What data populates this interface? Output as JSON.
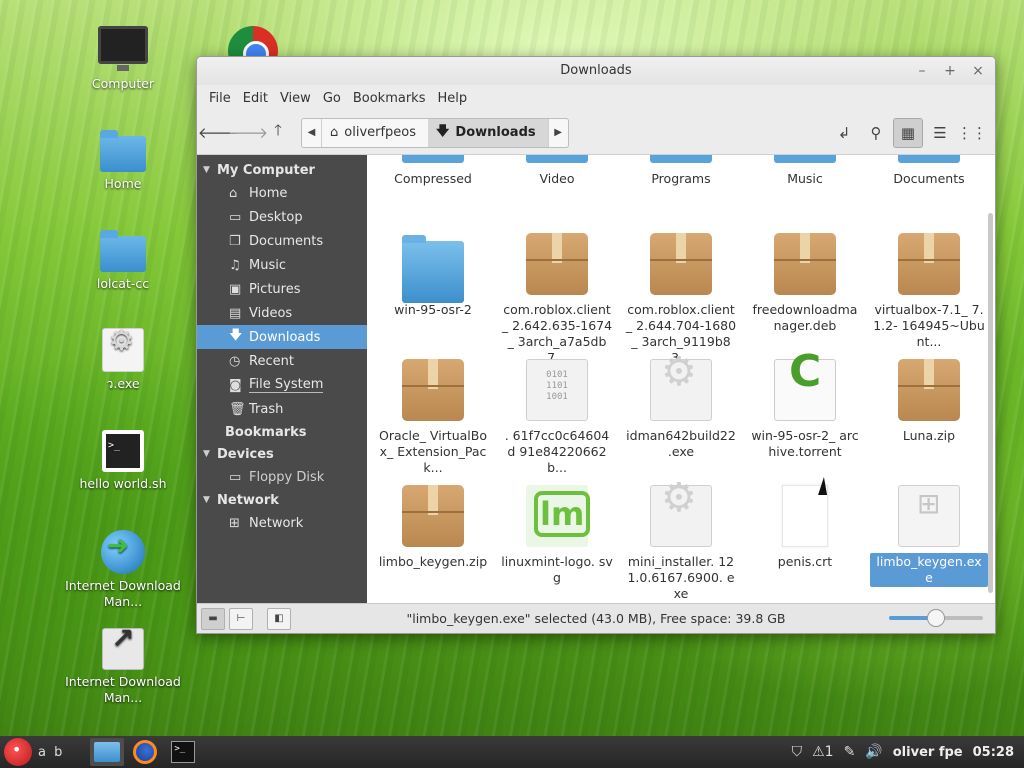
{
  "desktop": {
    "icons": [
      {
        "label": "Computer"
      },
      {
        "label": "Home"
      },
      {
        "label": "lolcat-cc"
      },
      {
        "label": "ว.exe"
      },
      {
        "label": "hello world.sh"
      },
      {
        "label": "Internet Download Man..."
      },
      {
        "label": "Internet Download Man..."
      }
    ]
  },
  "window": {
    "title": "Downloads",
    "controls": {
      "minimize": "–",
      "maximize": "+",
      "close": "×"
    },
    "menu": [
      "File",
      "Edit",
      "View",
      "Go",
      "Bookmarks",
      "Help"
    ],
    "path": {
      "home": "oliverfpeos",
      "current": "Downloads"
    },
    "sidebar": {
      "sections": [
        {
          "title": "My Computer",
          "items": [
            "Home",
            "Desktop",
            "Documents",
            "Music",
            "Pictures",
            "Videos",
            "Downloads",
            "Recent",
            "File System",
            "Trash"
          ]
        },
        {
          "title": "Bookmarks",
          "items": []
        },
        {
          "title": "Devices",
          "items": [
            "Floppy Disk"
          ]
        },
        {
          "title": "Network",
          "items": [
            "Network"
          ]
        }
      ]
    },
    "top_folders": [
      "Compressed",
      "Video",
      "Programs",
      "Music",
      "Documents"
    ],
    "files": [
      {
        "name": "win-95-osr-2",
        "kind": "folder"
      },
      {
        "name": "com.roblox.client_ 2.642.635-1674_ 3arch_a7a5db7...",
        "kind": "package"
      },
      {
        "name": "com.roblox.client_ 2.644.704-1680_ 3arch_9119b83...",
        "kind": "package"
      },
      {
        "name": "freedownloadma nager.deb",
        "kind": "package"
      },
      {
        "name": "virtualbox-7.1_ 7.1.2- 164945~Ubunt...",
        "kind": "package"
      },
      {
        "name": "Oracle_ VirtualBox_ Extension_Pack...",
        "kind": "package"
      },
      {
        "name": ". 61f7cc0c64604d 91e84220662b...",
        "kind": "binary"
      },
      {
        "name": "idman642build22 .exe",
        "kind": "gear"
      },
      {
        "name": "win-95-osr-2_ archive.torrent",
        "kind": "torrent"
      },
      {
        "name": "Luna.zip",
        "kind": "package"
      },
      {
        "name": "limbo_keygen.zip",
        "kind": "package"
      },
      {
        "name": "linuxmint-logo. svg",
        "kind": "mint"
      },
      {
        "name": "mini_installer. 121.0.6167.6900. exe",
        "kind": "gear"
      },
      {
        "name": "penis.crt",
        "kind": "blank"
      },
      {
        "name": "limbo_keygen.exe",
        "kind": "winexe",
        "selected": true
      }
    ],
    "status": "\"limbo_keygen.exe\" selected (43.0 MB), Free space: 39.8 GB",
    "zoom_level": 0.5
  },
  "panel": {
    "workspaces": "a b",
    "tray_count": "1",
    "user": "oliver fpe",
    "time": "05:28"
  }
}
